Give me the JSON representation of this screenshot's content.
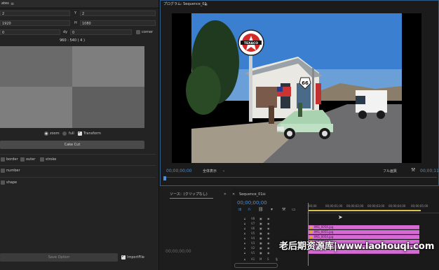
{
  "left_panel": {
    "title": "ates",
    "fields": {
      "x_value": "2",
      "y_label": "Y",
      "y_value": "2",
      "w_value": "1920",
      "h_label": "H",
      "h_value": "1080",
      "dx_value": "0",
      "dy_label": "dy",
      "dy_value": "0",
      "corner_label": "corner",
      "center_readout": "960 : 540 ( 4 )"
    },
    "modes": {
      "zoom": "zoom",
      "full": "full",
      "transform": "Transform"
    },
    "cake_cut": "Cake Cut",
    "options": {
      "border": "border",
      "outer": "outer",
      "stroke": "stroke",
      "number": "number",
      "shape": "shape"
    },
    "save_option": "Save Option",
    "import_file": "ImportFile"
  },
  "program_monitor": {
    "title": "プログラム: Sequence_01",
    "timecode_left": "00;00;00;00",
    "fit_label": "全体表示",
    "quality_label": "フル画質",
    "timecode_right": "00;00;11;"
  },
  "source_panel": {
    "tab": "ソース：(クリップなし)",
    "timecode": "00;00;00;00"
  },
  "timeline": {
    "tab": "Sequence_01",
    "timecode": "00;00;00;00",
    "ruler": [
      "00;00",
      "00;00;01;00",
      "00;00;02;00",
      "00;00;03;00",
      "00;00;04;00",
      "00;00;05;00"
    ],
    "tracks": [
      "V8",
      "V7",
      "V6",
      "V5",
      "V4",
      "V3",
      "V2",
      "V1",
      "A1"
    ],
    "clips": [
      "IMG_0056.jpg",
      "IMG_0055.jpg",
      "IMG_0054.jpg",
      "IMG_0053.jpg"
    ]
  },
  "photo": {
    "sign_text": "TEXACO",
    "route_text": "66"
  },
  "watermark": "老后期资源库|www.laohouqi.com"
}
